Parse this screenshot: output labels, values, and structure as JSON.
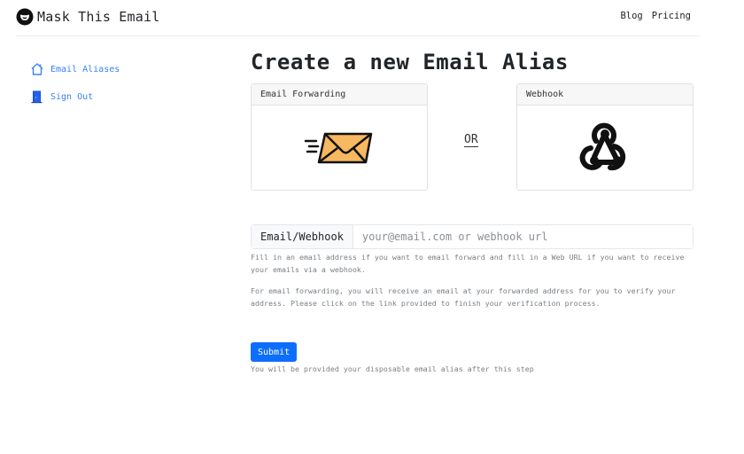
{
  "navbar": {
    "brand": "Mask This Email",
    "links": [
      "Blog",
      "Pricing"
    ]
  },
  "sidebar": {
    "items": [
      {
        "label": "Email Aliases",
        "icon": "home-icon"
      },
      {
        "label": "Sign Out",
        "icon": "door-icon"
      }
    ]
  },
  "main": {
    "title": "Create a new Email Alias",
    "cards": [
      {
        "header": "Email Forwarding",
        "icon": "envelope-icon"
      },
      {
        "header": "Webhook",
        "icon": "webhook-icon"
      }
    ],
    "or_label": "OR",
    "input": {
      "addon": "Email/Webhook",
      "value": "",
      "placeholder": "your@email.com or webhook url"
    },
    "help_1": "Fill in an email address if you want to email forward and fill in a Web URL if you want to receive your emails via a webhook.",
    "help_2": "For email forwarding, you will receive an email at your forwarded address for you to verify your address. Please click on the link provided to finish your verification process.",
    "submit_label": "Submit",
    "submit_note": "You will be provided your disposable email alias after this step"
  },
  "colors": {
    "link_blue": "#3b82f6",
    "button_blue": "#0d6efd",
    "envelope_fill": "#f8b85f"
  }
}
